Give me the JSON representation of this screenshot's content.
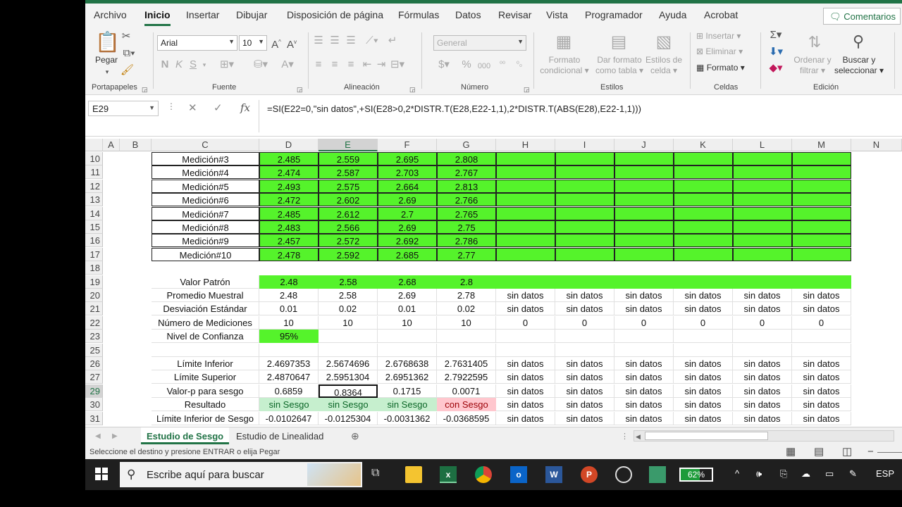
{
  "colors": {
    "excel_green": "#217346",
    "cell_green": "#55f32b",
    "good_fill": "#c6efce",
    "bad_fill": "#ffc7ce"
  },
  "ribbon": {
    "tabs": [
      "Archivo",
      "Inicio",
      "Insertar",
      "Dibujar",
      "Disposición de página",
      "Fórmulas",
      "Datos",
      "Revisar",
      "Vista",
      "Programador",
      "Ayuda",
      "Acrobat"
    ],
    "active_tab": "Inicio",
    "comments_label": "Comentarios",
    "paste_label": "Pegar",
    "font_name": "Arial",
    "font_size": "10",
    "number_format": "General",
    "conditional_format": [
      "Formato",
      "condicional"
    ],
    "format_table": [
      "Dar formato",
      "como tabla"
    ],
    "cell_styles": [
      "Estilos de",
      "celda"
    ],
    "insert_label": "Insertar",
    "delete_label": "Eliminar",
    "format_label": "Formato",
    "sort_filter": [
      "Ordenar y",
      "filtrar"
    ],
    "find_select": [
      "Buscar y",
      "seleccionar"
    ],
    "groups": [
      "Portapapeles",
      "Fuente",
      "Alineación",
      "Número",
      "Estilos",
      "Celdas",
      "Edición"
    ]
  },
  "formula_bar": {
    "name_box": "E29",
    "formula": "=SI(E22=0,\"sin datos\",+SI(E28>0,2*DISTR.T(E28,E22-1,1),2*DISTR.T(ABS(E28),E22-1,1)))"
  },
  "sheet": {
    "columns": [
      "A",
      "B",
      "C",
      "D",
      "E",
      "F",
      "G",
      "H",
      "I",
      "J",
      "K",
      "L",
      "M",
      "N"
    ],
    "row_numbers": [
      "10",
      "11",
      "12",
      "13",
      "14",
      "15",
      "16",
      "17",
      "18",
      "19",
      "20",
      "21",
      "22",
      "23",
      "25",
      "26",
      "27",
      "29",
      "30",
      "31"
    ],
    "measurements": [
      {
        "label": "Medición#3",
        "values": [
          "2.485",
          "2.559",
          "2.695",
          "2.808"
        ]
      },
      {
        "label": "Medición#4",
        "values": [
          "2.474",
          "2.587",
          "2.703",
          "2.767"
        ]
      },
      {
        "label": "Medición#5",
        "values": [
          "2.493",
          "2.575",
          "2.664",
          "2.813"
        ]
      },
      {
        "label": "Medición#6",
        "values": [
          "2.472",
          "2.602",
          "2.69",
          "2.766"
        ]
      },
      {
        "label": "Medición#7",
        "values": [
          "2.485",
          "2.612",
          "2.7",
          "2.765"
        ]
      },
      {
        "label": "Medición#8",
        "values": [
          "2.483",
          "2.566",
          "2.69",
          "2.75"
        ]
      },
      {
        "label": "Medición#9",
        "values": [
          "2.457",
          "2.572",
          "2.692",
          "2.786"
        ]
      },
      {
        "label": "Medición#10",
        "values": [
          "2.478",
          "2.592",
          "2.685",
          "2.77"
        ]
      }
    ],
    "summary": [
      {
        "row": "19",
        "label": "Valor Patrón",
        "values": [
          "2.48",
          "2.58",
          "2.68",
          "2.8",
          "",
          "",
          "",
          "",
          "",
          ""
        ]
      },
      {
        "row": "20",
        "label": "Promedio Muestral",
        "values": [
          "2.48",
          "2.58",
          "2.69",
          "2.78",
          "sin datos",
          "sin datos",
          "sin datos",
          "sin datos",
          "sin datos",
          "sin datos"
        ]
      },
      {
        "row": "21",
        "label": "Desviación Estándar",
        "values": [
          "0.01",
          "0.02",
          "0.01",
          "0.02",
          "sin datos",
          "sin datos",
          "sin datos",
          "sin datos",
          "sin datos",
          "sin datos"
        ]
      },
      {
        "row": "22",
        "label": "Número de Mediciones",
        "values": [
          "10",
          "10",
          "10",
          "10",
          "0",
          "0",
          "0",
          "0",
          "0",
          "0"
        ]
      },
      {
        "row": "23",
        "label": "Nivel de Confianza",
        "values": [
          "95%",
          "",
          "",
          "",
          "",
          "",
          "",
          "",
          "",
          ""
        ]
      },
      {
        "row": "25",
        "label": "",
        "values": [
          "",
          "",
          "",
          "",
          "",
          "",
          "",
          "",
          "",
          ""
        ]
      },
      {
        "row": "26",
        "label": "Límite Inferior",
        "values": [
          "2.4697353",
          "2.5674696",
          "2.6768638",
          "2.7631405",
          "sin datos",
          "sin datos",
          "sin datos",
          "sin datos",
          "sin datos",
          "sin datos"
        ]
      },
      {
        "row": "27",
        "label": "Límite Superior",
        "values": [
          "2.4870647",
          "2.5951304",
          "2.6951362",
          "2.7922595",
          "sin datos",
          "sin datos",
          "sin datos",
          "sin datos",
          "sin datos",
          "sin datos"
        ]
      },
      {
        "row": "29",
        "label": "Valor-p para sesgo",
        "values": [
          "0.6859",
          "0.8364",
          "0.1715",
          "0.0071",
          "sin datos",
          "sin datos",
          "sin datos",
          "sin datos",
          "sin datos",
          "sin datos"
        ]
      },
      {
        "row": "30",
        "label": "Resultado",
        "values": [
          "sin Sesgo",
          "sin Sesgo",
          "sin Sesgo",
          "con Sesgo",
          "sin datos",
          "sin datos",
          "sin datos",
          "sin datos",
          "sin datos",
          "sin datos"
        ]
      },
      {
        "row": "31",
        "label": "Límite Inferior de Sesgo",
        "values": [
          "-0.0102647",
          "-0.0125304",
          "-0.0031362",
          "-0.0368595",
          "sin datos",
          "sin datos",
          "sin datos",
          "sin datos",
          "sin datos",
          "sin datos"
        ]
      }
    ]
  },
  "sheet_tabs": [
    "Estudio de Sesgo",
    "Estudio de Linealidad"
  ],
  "active_sheet": "Estudio de Sesgo",
  "status_message": "Seleccione el destino y presione ENTRAR o elija Pegar",
  "taskbar": {
    "search_placeholder": "Escribe aquí para buscar",
    "battery_percent": "62%",
    "battery_level": 0.62,
    "language": "ESP"
  }
}
